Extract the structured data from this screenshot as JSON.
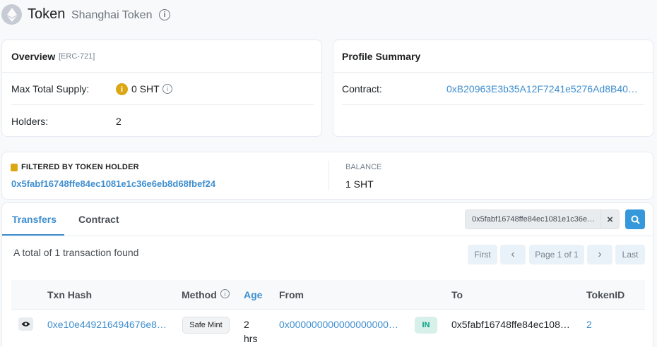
{
  "header": {
    "title": "Token",
    "subtitle": "Shanghai Token"
  },
  "overview": {
    "heading": "Overview",
    "standard": "[ERC-721]",
    "max_supply_label": "Max Total Supply:",
    "max_supply_value": "0 SHT",
    "holders_label": "Holders:",
    "holders_value": "2"
  },
  "profile": {
    "heading": "Profile Summary",
    "contract_label": "Contract:",
    "contract_value": "0xB20963E3b35A12F7241e5276Ad8B40…"
  },
  "filter": {
    "label": "FILTERED BY TOKEN HOLDER",
    "address": "0x5fabf16748ffe84ec1081e1c36e6eb8d68fbef24",
    "balance_label": "BALANCE",
    "balance_value": "1 SHT"
  },
  "tabs": [
    {
      "label": "Transfers",
      "active": true
    },
    {
      "label": "Contract",
      "active": false
    }
  ],
  "search": {
    "value": "0x5fabf16748ffe84ec1081e1c36e…"
  },
  "summary": "A total of 1 transaction found",
  "pagination": {
    "first": "First",
    "prev": "‹",
    "page": "Page 1 of 1",
    "next": "›",
    "last": "Last"
  },
  "table": {
    "columns": {
      "txn_hash": "Txn Hash",
      "method": "Method",
      "age": "Age",
      "from": "From",
      "to": "To",
      "token_id": "TokenID"
    },
    "rows": [
      {
        "txn_hash": "0xe10e449216494676e8…",
        "method": "Safe Mint",
        "age_1": "2",
        "age_2": "hrs",
        "from": "0x000000000000000000…",
        "direction": "IN",
        "to": "0x5fabf16748ffe84ec108…",
        "token_id": "2"
      }
    ]
  },
  "colors": {
    "link": "#3e8ecf",
    "accent_button": "#3498db",
    "in_badge_bg": "#d7f0ea",
    "in_badge_text": "#00a186",
    "warning": "#dba713"
  }
}
